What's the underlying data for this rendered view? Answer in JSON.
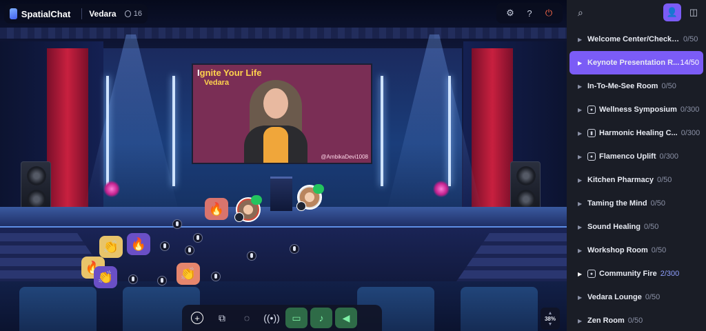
{
  "app": {
    "brand_name": "SpatialChat",
    "space_name": "Vedara",
    "participant_count": "16"
  },
  "top_controls": [
    {
      "name": "settings",
      "icon": "gear-icon"
    },
    {
      "name": "help",
      "icon": "question-icon"
    },
    {
      "name": "leave",
      "icon": "power-icon"
    }
  ],
  "presentation": {
    "title": "Ignite Your Life",
    "subtitle": "Vedara",
    "handle": "@AmbikaDevi1008"
  },
  "reactions": [
    "🔥",
    "🔥",
    "👏",
    "🔥",
    "👏",
    "👏"
  ],
  "toolbar": {
    "buttons": [
      {
        "name": "add",
        "icon": "plus-circle-icon",
        "glyph": "+"
      },
      {
        "name": "share-screen",
        "icon": "screen-share-icon",
        "glyph": "▭"
      },
      {
        "name": "chat",
        "icon": "chat-bubble-icon",
        "glyph": "💬"
      },
      {
        "name": "broadcast",
        "icon": "broadcast-icon",
        "glyph": "((•))"
      },
      {
        "name": "camera",
        "icon": "video-camera-icon",
        "glyph": "▶"
      },
      {
        "name": "microphone",
        "icon": "microphone-icon",
        "glyph": "🎤"
      },
      {
        "name": "megaphone",
        "icon": "megaphone-icon",
        "glyph": "📢"
      }
    ]
  },
  "zoom": {
    "value": "38%"
  },
  "sidebar": {
    "rooms": [
      {
        "name": "Welcome Center/Check In",
        "count": "0/50",
        "icon": "",
        "active": false
      },
      {
        "name": "Keynote Presentation R...",
        "count": "14/50",
        "icon": "",
        "active": true
      },
      {
        "name": "In-To-Me-See Room",
        "count": "0/50",
        "icon": "",
        "active": false
      },
      {
        "name": "Wellness Symposium",
        "count": "0/300",
        "icon": "user-icon",
        "active": false
      },
      {
        "name": "Harmonic Healing C...",
        "count": "0/300",
        "icon": "mic-icon",
        "active": false
      },
      {
        "name": "Flamenco Uplift",
        "count": "0/300",
        "icon": "user-icon",
        "active": false
      },
      {
        "name": "Kitchen Pharmacy",
        "count": "0/50",
        "icon": "",
        "active": false
      },
      {
        "name": "Taming the Mind",
        "count": "0/50",
        "icon": "",
        "active": false
      },
      {
        "name": "Sound Healing",
        "count": "0/50",
        "icon": "",
        "active": false
      },
      {
        "name": "Workshop Room",
        "count": "0/50",
        "icon": "",
        "active": false
      },
      {
        "name": "Community Fire",
        "count": "2/300",
        "icon": "user-icon",
        "active": false
      },
      {
        "name": "Vedara Lounge",
        "count": "0/50",
        "icon": "",
        "active": false
      },
      {
        "name": "Zen Room",
        "count": "0/50",
        "icon": "",
        "active": false
      }
    ]
  },
  "colors": {
    "accent": "#7b5cf6",
    "curtain": "#c8203f",
    "screen_bg": "#7a2e55",
    "active_green": "#2e6b47",
    "leave_red": "#ff6b4a"
  }
}
